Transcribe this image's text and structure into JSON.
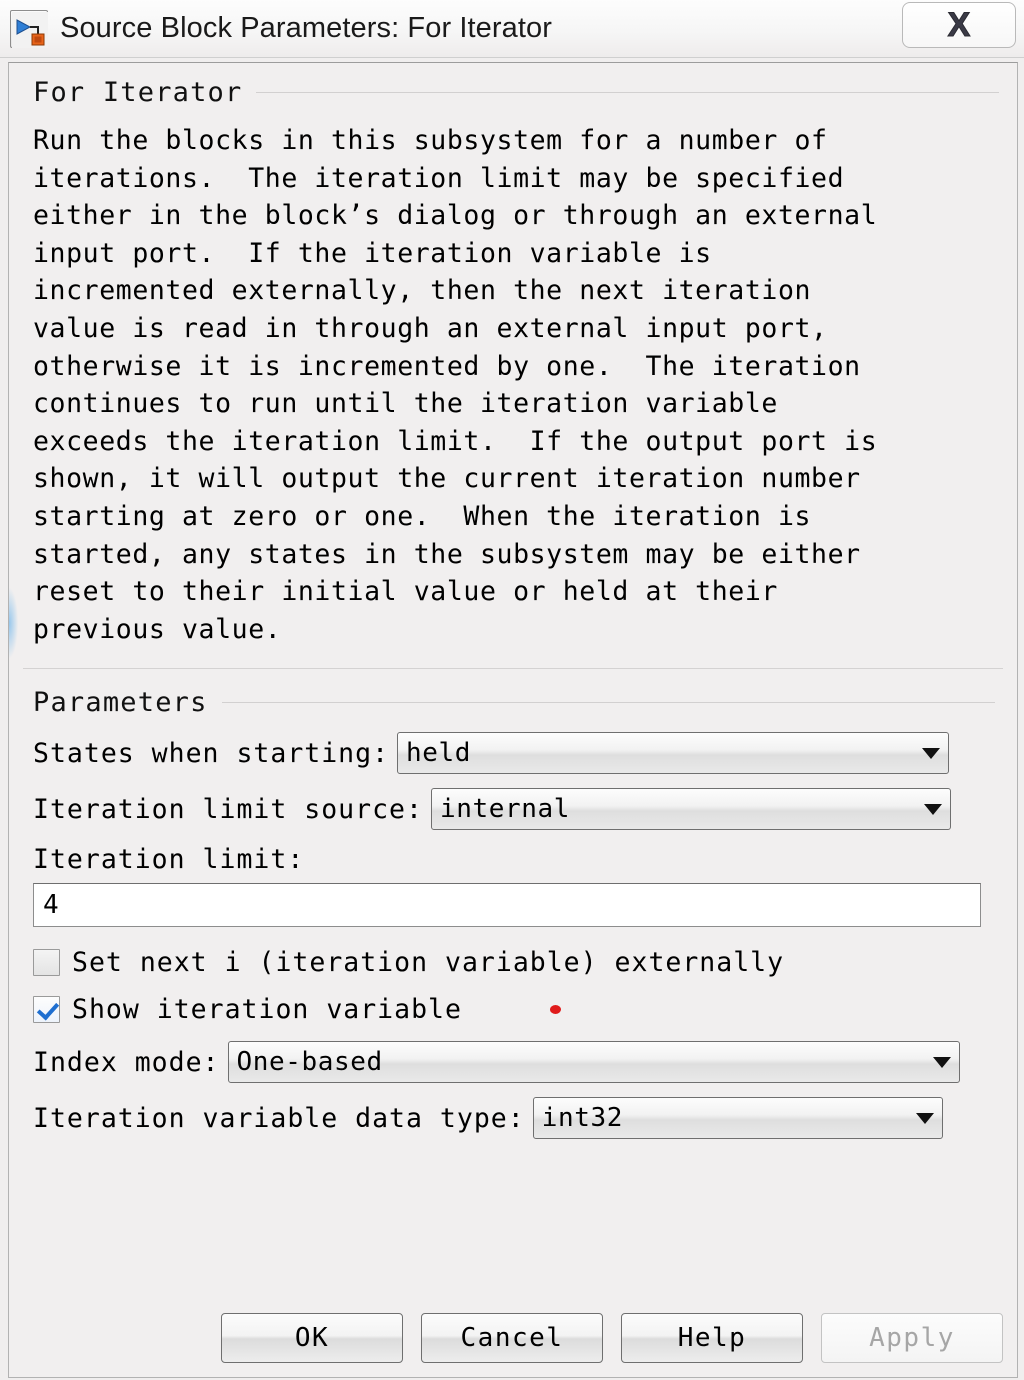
{
  "window": {
    "title": "Source Block Parameters: For Iterator",
    "icon": "simulink-block-icon",
    "close_label": "X"
  },
  "description": {
    "heading": "For Iterator",
    "body": "Run the blocks in this subsystem for a number of\niterations.  The iteration limit may be specified\neither in the block’s dialog or through an external\ninput port.  If the iteration variable is\nincremented externally, then the next iteration\nvalue is read in through an external input port,\notherwise it is incremented by one.  The iteration\ncontinues to run until the iteration variable\nexceeds the iteration limit.  If the output port is\nshown, it will output the current iteration number\nstarting at zero or one.  When the iteration is\nstarted, any states in the subsystem may be either\nreset to their initial value or held at their\nprevious value."
  },
  "parameters": {
    "heading": "Parameters",
    "states_when_starting": {
      "label": "States when starting:",
      "value": "held"
    },
    "iteration_limit_source": {
      "label": "Iteration limit source:",
      "value": "internal"
    },
    "iteration_limit": {
      "label": "Iteration limit:",
      "value": "4"
    },
    "set_next_i_externally": {
      "label": "Set next i (iteration variable) externally",
      "checked": false
    },
    "show_iteration_variable": {
      "label": "Show iteration variable",
      "checked": true
    },
    "index_mode": {
      "label": "Index mode:",
      "value": "One-based"
    },
    "iteration_variable_data_type": {
      "label": "Iteration variable data type:",
      "value": "int32"
    }
  },
  "footer": {
    "ok": "OK",
    "cancel": "Cancel",
    "help": "Help",
    "apply": "Apply"
  },
  "colors": {
    "accent_check": "#1f6fd0",
    "cursor_marker": "#e01b1b",
    "dialog_bg": "#f1efef"
  }
}
